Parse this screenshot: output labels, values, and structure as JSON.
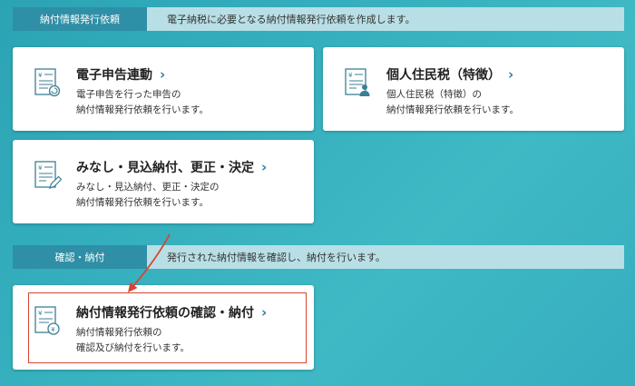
{
  "section1": {
    "label": "納付情報発行依頼",
    "description": "電子納税に必要となる納付情報発行依頼を作成します。"
  },
  "cards": [
    {
      "title": "電子申告連動",
      "desc_line1": "電子申告を行った申告の",
      "desc_line2": "納付情報発行依頼を行います。",
      "icon": "document-refresh-icon"
    },
    {
      "title": "個人住民税（特徴）",
      "desc_line1": "個人住民税（特徴）の",
      "desc_line2": "納付情報発行依頼を行います。",
      "icon": "document-person-icon"
    },
    {
      "title": "みなし・見込納付、更正・決定",
      "desc_line1": "みなし・見込納付、更正・決定の",
      "desc_line2": "納付情報発行依頼を行います。",
      "icon": "document-pen-icon"
    }
  ],
  "section2": {
    "label": "確認・納付",
    "description": "発行された納付情報を確認し、納付を行います。"
  },
  "confirm_card": {
    "title": "納付情報発行依頼の確認・納付",
    "desc_line1": "納付情報発行依頼の",
    "desc_line2": "確認及び納付を行います。",
    "icon": "document-coin-icon"
  },
  "colors": {
    "section_label_bg": "#2e8fa6",
    "section_desc_bg": "#b9dfe6",
    "highlight": "#d9432f",
    "chevron": "#2a7fa0"
  }
}
